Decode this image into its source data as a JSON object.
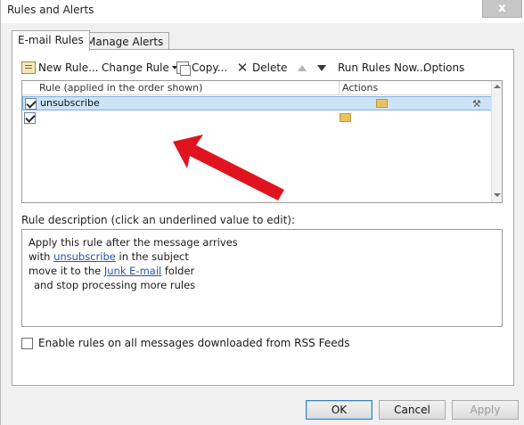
{
  "window": {
    "title": "Rules and Alerts",
    "close_glyph": "x"
  },
  "tabs": [
    {
      "label": "E-mail Rules",
      "active": true
    },
    {
      "label": "Manage Alerts",
      "active": false
    }
  ],
  "toolbar": {
    "new_rule": "New Rule...",
    "change_rule": "Change Rule",
    "copy": "Copy...",
    "delete": "Delete",
    "run_rules_now": "Run Rules Now...",
    "options": "Options"
  },
  "rules_list": {
    "columns": [
      "Rule (applied in the order shown)",
      "Actions"
    ],
    "rows": [
      {
        "name": "unsubscribe",
        "checked": true,
        "selected": true
      },
      {
        "name": "",
        "checked": true,
        "selected": false
      }
    ]
  },
  "description": {
    "label": "Rule description (click an underlined value to edit):",
    "line1": "Apply this rule after the message arrives",
    "line2_pre": "with ",
    "line2_link": "unsubscribe",
    "line2_post": " in the subject",
    "line3_pre": "move it to the ",
    "line3_link": "Junk E-mail",
    "line3_post": " folder",
    "line4": "and stop processing more rules"
  },
  "rss_option": {
    "label": "Enable rules on all messages downloaded from RSS Feeds",
    "checked": false
  },
  "buttons": {
    "ok": "OK",
    "cancel": "Cancel",
    "apply": "Apply"
  },
  "colors": {
    "selection": "#cde3f7",
    "link": "#2355a8",
    "annotation_arrow": "#e0141f"
  }
}
